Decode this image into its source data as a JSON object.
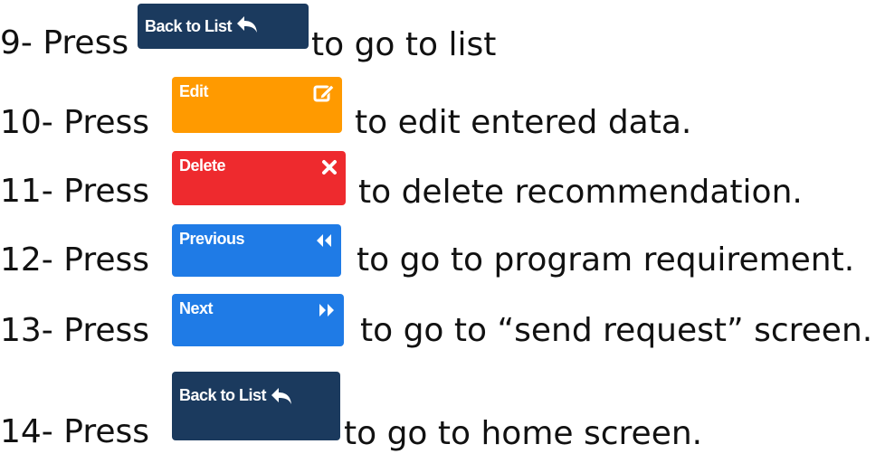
{
  "steps": [
    {
      "prefix": "9- Press",
      "button": {
        "label": "Back to List",
        "icon": "reply-arrow-icon",
        "color": "#1b3a5e"
      },
      "suffix": "to go to list"
    },
    {
      "prefix": "10-  Press",
      "button": {
        "label": "Edit",
        "icon": "edit-icon",
        "color": "#ff9a00"
      },
      "suffix": "to edit entered data."
    },
    {
      "prefix": "11-  Press",
      "button": {
        "label": "Delete",
        "icon": "close-icon",
        "color": "#ee2a2e"
      },
      "suffix": "to delete recommendation."
    },
    {
      "prefix": "12-  Press",
      "button": {
        "label": "Previous",
        "icon": "double-chevron-left-icon",
        "color": "#1f7be6"
      },
      "suffix": "to go to program requirement."
    },
    {
      "prefix": "13-  Press",
      "button": {
        "label": "Next",
        "icon": "double-chevron-right-icon",
        "color": "#1f7be6"
      },
      "suffix": "to go to “send request” screen."
    },
    {
      "prefix": "14-  Press",
      "button": {
        "label": "Back to List",
        "icon": "reply-arrow-icon",
        "color": "#1b3a5e"
      },
      "suffix": "to go to home screen."
    }
  ]
}
